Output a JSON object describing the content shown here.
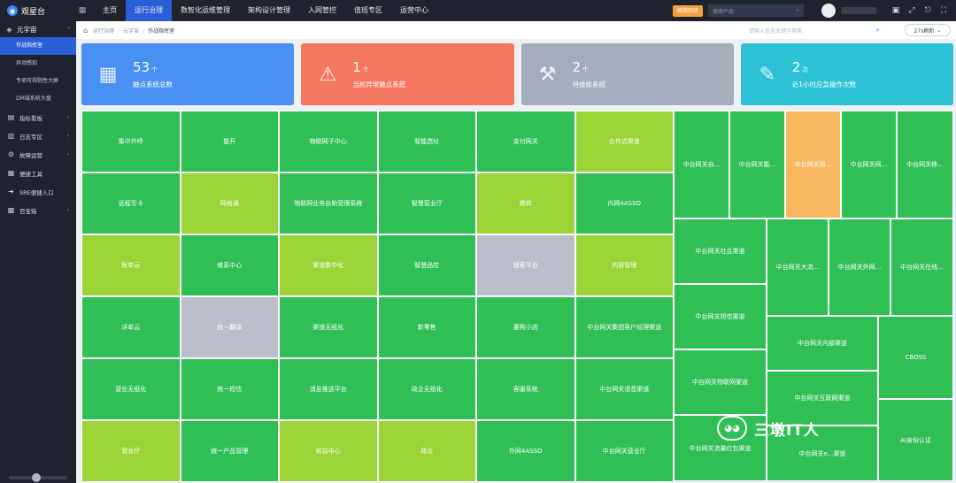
{
  "app": {
    "brand": "观星台"
  },
  "nav": [
    "主页",
    "运行治理",
    "数智化运维管理",
    "架构设计管理",
    "入网管控",
    "值班专区",
    "运营中心"
  ],
  "top": {
    "fault_label": "故障回放",
    "search_placeholder": "搜索产品"
  },
  "sidebar": {
    "group": "元宇宙",
    "subs": [
      "作战指挥室",
      "异动感知",
      "专项可视剔性大屏",
      "DM域系统大盘"
    ],
    "items": [
      {
        "label": "指标看板",
        "icon": "chart-icon",
        "chev": true
      },
      {
        "label": "日志专区",
        "icon": "log-icon",
        "chev": true
      },
      {
        "label": "故障运营",
        "icon": "alert-icon",
        "chev": true
      },
      {
        "label": "便捷工具",
        "icon": "tool-icon",
        "chev": false
      },
      {
        "label": "SRE便捷入口",
        "icon": "entry-icon",
        "chev": false
      },
      {
        "label": "百宝箱",
        "icon": "box-icon",
        "chev": true
      }
    ]
  },
  "breadcrumb": [
    "运行治理",
    "元宇宙",
    "作战指挥室"
  ],
  "crumb_search_placeholder": "请输入任务关键字搜索",
  "refresh_label": "27s刷新",
  "stats": [
    {
      "num": "53",
      "unit": "个",
      "label": "触点系统总数",
      "color": "#4a90f2",
      "icon": "grid-icon"
    },
    {
      "num": "1",
      "unit": "个",
      "label": "当前异常触点系统",
      "color": "#f4775f",
      "icon": "alarm-icon"
    },
    {
      "num": "2",
      "unit": "个",
      "label": "待维修系统",
      "color": "#a5adbd",
      "icon": "wrench-icon"
    },
    {
      "num": "2",
      "unit": "次",
      "label": "近1小时应急操作次数",
      "color": "#2ec2d6",
      "icon": "edit-icon"
    }
  ],
  "colors": {
    "green": "#2fbf55",
    "lime": "#9ad437",
    "gray": "#b9bec8",
    "orange": "#f7b860"
  },
  "tiles": [
    {
      "label": "集中外呼",
      "c": "green"
    },
    {
      "label": "能开",
      "c": "green"
    },
    {
      "label": "物联网子中心",
      "c": "green"
    },
    {
      "label": "智能选址",
      "c": "green"
    },
    {
      "label": "支付网关",
      "c": "green"
    },
    {
      "label": "合作式渠道",
      "c": "lime"
    },
    {
      "label": "远程写卡",
      "c": "green"
    },
    {
      "label": "网格通",
      "c": "lime"
    },
    {
      "label": "物联网业务自助受理系统",
      "c": "green"
    },
    {
      "label": "智慧营业厅",
      "c": "green"
    },
    {
      "label": "携转",
      "c": "lime"
    },
    {
      "label": "内网4ASSO",
      "c": "green"
    },
    {
      "label": "账单云",
      "c": "lime"
    },
    {
      "label": "维系中心",
      "c": "green"
    },
    {
      "label": "渠道集中化",
      "c": "lime"
    },
    {
      "label": "智慧品控",
      "c": "green"
    },
    {
      "label": "搜索平台",
      "c": "gray"
    },
    {
      "label": "内容管理",
      "c": "lime"
    },
    {
      "label": "详单云",
      "c": "green"
    },
    {
      "label": "统一翻译",
      "c": "gray"
    },
    {
      "label": "渠道无纸化",
      "c": "green"
    },
    {
      "label": "新零售",
      "c": "green"
    },
    {
      "label": "惠购小店",
      "c": "green"
    },
    {
      "label": "中台网关集团客户经理渠道",
      "c": "green"
    },
    {
      "label": "营业无纸化",
      "c": "green"
    },
    {
      "label": "统一短信",
      "c": "green"
    },
    {
      "label": "消息推送平台",
      "c": "green"
    },
    {
      "label": "政企无纸化",
      "c": "green"
    },
    {
      "label": "客服系统",
      "c": "green"
    },
    {
      "label": "中台网关语音渠道",
      "c": "green"
    },
    {
      "label": "营业厅",
      "c": "lime"
    },
    {
      "label": "统一产品管理",
      "c": "green"
    },
    {
      "label": "权益中心",
      "c": "lime"
    },
    {
      "label": "政企",
      "c": "lime"
    },
    {
      "label": "外网4ASSO",
      "c": "green"
    },
    {
      "label": "中台网关营业厅",
      "c": "green"
    }
  ],
  "right_tiles": [
    {
      "label": "中台网关自...",
      "c": "green"
    },
    {
      "label": "中台网关能...",
      "c": "green"
    },
    {
      "label": "中台网关网...",
      "c": "orange"
    },
    {
      "label": "中台网关网...",
      "c": "green"
    },
    {
      "label": "中台网关移...",
      "c": "green"
    },
    {
      "label": "中台网关社会渠道",
      "c": "green"
    },
    {
      "label": "中台网关大流...",
      "c": "green"
    },
    {
      "label": "中台网关外网...",
      "c": "green"
    },
    {
      "label": "中台网关在线...",
      "c": "green"
    },
    {
      "label": "中台网关短信渠道",
      "c": "green"
    },
    {
      "label": "中台网关内部渠道",
      "c": "green"
    },
    {
      "label": "CBOSS",
      "c": "green"
    },
    {
      "label": "中台网关物联网渠道",
      "c": "green"
    },
    {
      "label": "中台网关互联网渠道",
      "c": "green"
    },
    {
      "label": "中台网关流量红包渠道",
      "c": "green"
    },
    {
      "label": "中台网关e...渠道",
      "c": "green"
    },
    {
      "label": "AI身份认证",
      "c": "green"
    }
  ],
  "watermark": {
    "text": "三墩IT人"
  }
}
